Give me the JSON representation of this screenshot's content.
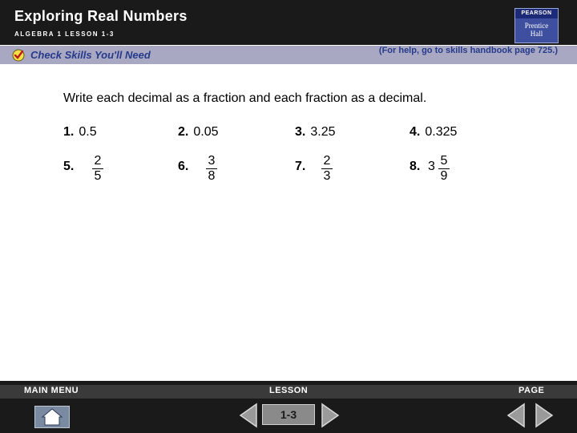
{
  "header": {
    "title": "Exploring Real Numbers",
    "subtitle": "ALGEBRA 1  LESSON 1-3",
    "logo_top": "PEARSON",
    "logo_bottom_1": "Prentice",
    "logo_bottom_2": "Hall"
  },
  "skills_bar": {
    "label": "Check Skills You'll Need",
    "help": "(For help, go to skills handbook page 725.)"
  },
  "instructions": "Write each decimal as a fraction and each fraction as a decimal.",
  "problems": [
    {
      "number": "1.",
      "value": "0.5"
    },
    {
      "number": "2.",
      "value": "0.05"
    },
    {
      "number": "3.",
      "value": "3.25"
    },
    {
      "number": "4.",
      "value": "0.325"
    },
    {
      "number": "5.",
      "numerator": "2",
      "denominator": "5"
    },
    {
      "number": "6.",
      "numerator": "3",
      "denominator": "8"
    },
    {
      "number": "7.",
      "numerator": "2",
      "denominator": "3"
    },
    {
      "number": "8.",
      "whole": "3",
      "numerator": "5",
      "denominator": "9"
    }
  ],
  "footer": {
    "main_menu": "MAIN MENU",
    "lesson": "LESSON",
    "page": "PAGE",
    "lesson_number": "1-3"
  }
}
